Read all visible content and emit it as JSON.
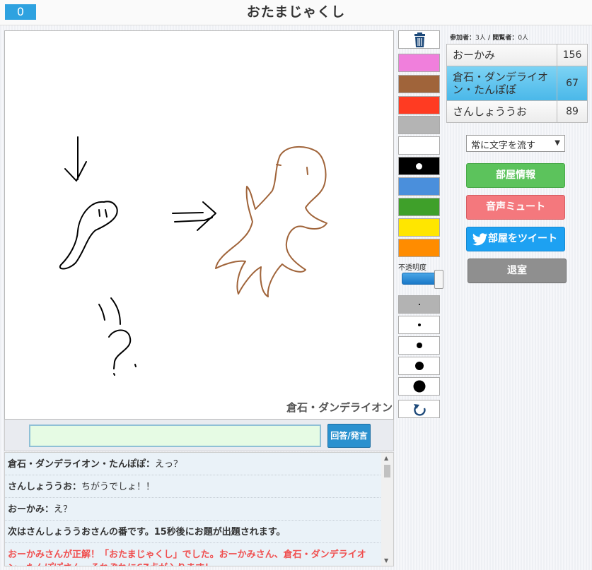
{
  "header": {
    "counter": "0",
    "title": "おたまじゃくし"
  },
  "canvas": {
    "drawer_name": "倉石・ダンデライオン"
  },
  "input": {
    "value": "",
    "submit_label": "回答/発言"
  },
  "chat": [
    {
      "name": "倉石・ダンデライオン・たんぽぽ：",
      "msg": "えっ？",
      "type": "user"
    },
    {
      "name": "さんしょううお：",
      "msg": "ちがうでしょ！！",
      "type": "user"
    },
    {
      "name": "おーかみ：",
      "msg": "え？",
      "type": "user"
    },
    {
      "name": "次はさんしょううおさんの番です。15秒後にお題が出題されます。",
      "msg": "",
      "type": "system"
    },
    {
      "name": "おーかみさんが正解！「おたまじゃくし」でした。おーかみさん、倉石・ダンデライオン・たんぽぽさん、それぞれに67点が入ります！",
      "msg": "",
      "type": "correct"
    }
  ],
  "tools": {
    "colors": [
      "#f07fdc",
      "#a0643a",
      "#ff3b22",
      "#b4b4b4",
      "#ffffff",
      "#000000",
      "#4a8fdc",
      "#3fa02a",
      "#ffe600",
      "#ff8c00"
    ],
    "selected_color_index": 5,
    "opacity_label": "不透明度",
    "opacity_value": 1.0,
    "pen_sizes": [
      2,
      4,
      8,
      12,
      17
    ],
    "selected_pen_index": 0
  },
  "stats": {
    "participants_label": "参加者：",
    "participants": "3人",
    "separator": " / ",
    "viewers_label": "閲覧者：",
    "viewers": "0人"
  },
  "players": [
    {
      "name": "おーかみ",
      "score": "156",
      "active": false
    },
    {
      "name": "倉石・ダンデライオン・たんぽぽ",
      "score": "67",
      "active": true
    },
    {
      "name": "さんしょううお",
      "score": "89",
      "active": false
    }
  ],
  "controls": {
    "scroll_mode": "常に文字を流す",
    "room_info": "部屋情報",
    "mute": "音声ミュート",
    "tweet": "部屋をツイート",
    "leave": "退室"
  }
}
